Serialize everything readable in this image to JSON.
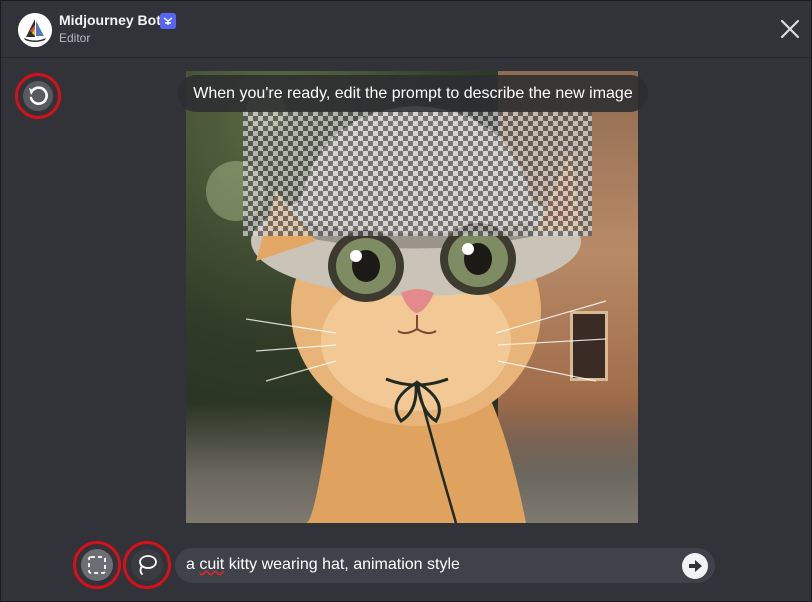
{
  "header": {
    "bot_name": "Midjourney Bot",
    "bot_badge": "",
    "subtitle": "Editor",
    "close_icon": "close-icon"
  },
  "editor": {
    "tooltip": "When you're ready, edit the prompt to describe the new image",
    "image_alt": "cat-in-hat-image",
    "prompt_value": "a cuit kitty wearing hat, animation style",
    "prompt_typo": "cuit",
    "prompt_before_typo": "a ",
    "prompt_after_typo": " kitty wearing hat, animation style"
  },
  "tools": {
    "undo_icon": "undo-icon",
    "rectangle_icon": "rectangle-select-icon",
    "lasso_icon": "lasso-select-icon",
    "send_icon": "send-arrow-icon"
  },
  "colors": {
    "background": "#313338",
    "highlight_ring": "#d5101b",
    "badge": "#5865f2",
    "prompt_bg": "#404249"
  }
}
